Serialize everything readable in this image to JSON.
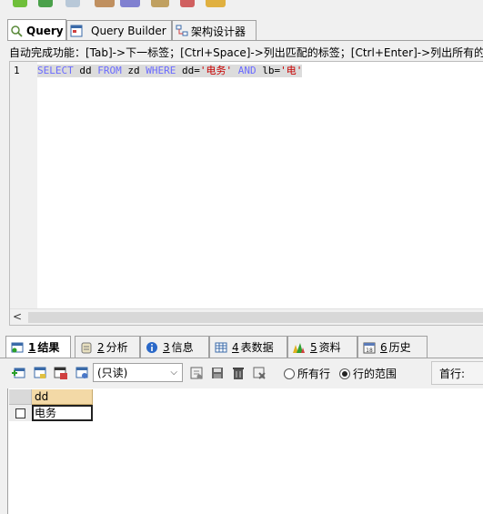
{
  "editor_tabs": [
    {
      "label": "Query",
      "active": true,
      "icon": "query-icon"
    },
    {
      "label": "Query Builder",
      "active": false,
      "icon": "query-builder-icon"
    },
    {
      "label": "架构设计器",
      "active": false,
      "icon": "schema-designer-icon"
    }
  ],
  "hint": "自动完成功能：[Tab]->下一标签；[Ctrl+Space]->列出匹配的标签；[Ctrl+Enter]->列出所有的标签",
  "editor": {
    "line_number": "1",
    "sql_tokens": [
      {
        "text": "SELECT",
        "type": "kw"
      },
      {
        "text": " dd ",
        "type": "plain"
      },
      {
        "text": "FROM",
        "type": "kw"
      },
      {
        "text": " zd ",
        "type": "plain"
      },
      {
        "text": "WHERE",
        "type": "kw"
      },
      {
        "text": " dd=",
        "type": "plain"
      },
      {
        "text": "'电务'",
        "type": "str"
      },
      {
        "text": " ",
        "type": "plain"
      },
      {
        "text": "AND",
        "type": "kw"
      },
      {
        "text": " lb=",
        "type": "plain"
      },
      {
        "text": "'电'",
        "type": "str"
      }
    ],
    "scroll_left_arrow": "<"
  },
  "result_tabs": [
    {
      "num": "1",
      "label": "结果",
      "active": true,
      "icon": "table-result-icon"
    },
    {
      "num": "2",
      "label": "分析",
      "active": false,
      "icon": "profile-icon"
    },
    {
      "num": "3",
      "label": "信息",
      "active": false,
      "icon": "info-icon"
    },
    {
      "num": "4",
      "label": "表数据",
      "active": false,
      "icon": "table-data-icon"
    },
    {
      "num": "5",
      "label": "资料",
      "active": false,
      "icon": "chart-icon"
    },
    {
      "num": "6",
      "label": "历史",
      "active": false,
      "icon": "calendar-icon"
    }
  ],
  "result_toolbar": {
    "select_value": "(只读)",
    "radio_all_label": "所有行",
    "radio_range_label": "行的范围",
    "radio_selected": "range",
    "first_row_label": "首行:"
  },
  "grid": {
    "columns": [
      "dd"
    ],
    "rows": [
      [
        "电务"
      ]
    ]
  },
  "colors": {
    "keyword": "#6a6aff",
    "string": "#c80000",
    "header_col": "#f3d9a6"
  }
}
